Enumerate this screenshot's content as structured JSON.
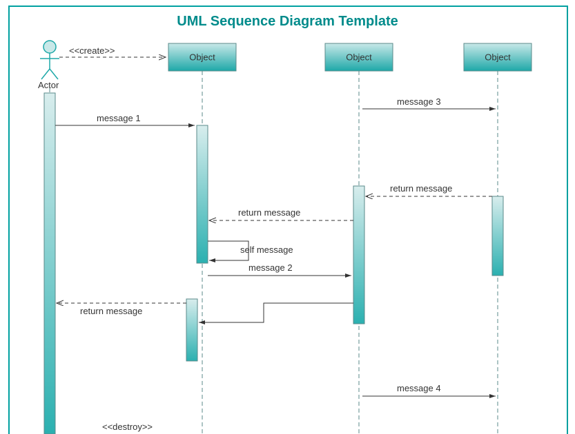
{
  "title": "UML Sequence Diagram Template",
  "actor": {
    "label": "Actor"
  },
  "objects": [
    {
      "label": "Object"
    },
    {
      "label": "Object"
    },
    {
      "label": "Object"
    }
  ],
  "messages": {
    "create": "<<create>>",
    "destroy": "<<destroy>>",
    "msg1": "message 1",
    "msg2": "message 2",
    "msg3": "message 3",
    "msg4": "message 4",
    "return1": "return message",
    "return2": "return message",
    "return3": "return message",
    "self": "self message"
  }
}
